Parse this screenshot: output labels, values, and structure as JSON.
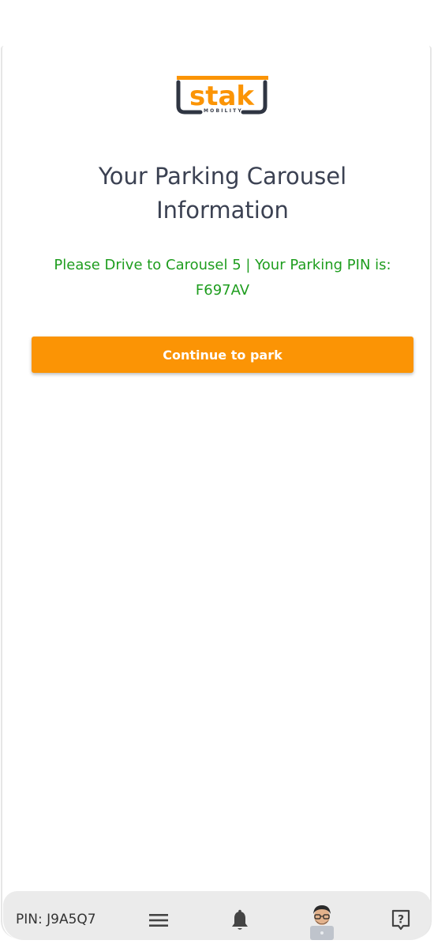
{
  "brand": {
    "logo_text": "stak",
    "logo_subtext": "MOBILITY",
    "accent_color": "#fb9405",
    "dark_color": "#2f3542"
  },
  "page": {
    "title": "Your Parking Carousel Information",
    "message": "Please Drive to Carousel 5 | Your Parking PIN is: F697AV",
    "message_color": "#1e9d1e"
  },
  "actions": {
    "continue_label": "Continue to park"
  },
  "bottom_nav": {
    "pin_label": "PIN: J9A5Q7",
    "items": [
      {
        "icon": "menu-icon"
      },
      {
        "icon": "bell-icon"
      },
      {
        "icon": "avatar"
      },
      {
        "icon": "help-icon"
      }
    ]
  }
}
